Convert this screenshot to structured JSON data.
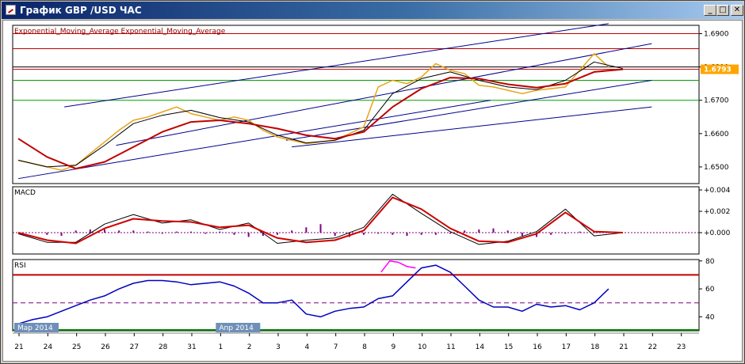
{
  "window": {
    "title": "График GBP /USD  ЧАС",
    "buttons": {
      "minimize": "_",
      "maximize": "□",
      "close": "✕"
    }
  },
  "colors": {
    "price": "#e8a317",
    "ema_fast": "#000000",
    "ema_slow": "#c00000",
    "channel": "#00008b",
    "level_red": "#c00000",
    "level_green": "#00a000",
    "level_dark": "#000000",
    "macd_line": "#000000",
    "macd_signal": "#d00000",
    "macd_hist": "#800080",
    "rsi_line": "#0000c0",
    "rsi_overbought": "#ff00ff",
    "rsi_upper": "#c00000",
    "rsi_lower": "#008000",
    "rsi_mid": "#800080",
    "current_price_label": "#ffa500"
  },
  "chart_data": [
    {
      "type": "line",
      "panel": "price",
      "indicator_legend": "Exponential_Moving_Average Exponential_Moving_Average",
      "y_ticks": [
        "1.6900",
        "1.6800",
        "1.6700",
        "1.6600",
        "1.6500"
      ],
      "ylim": [
        1.645,
        1.6925
      ],
      "current_price": "1.6793",
      "horizontal_levels": [
        {
          "value": 1.69,
          "color": "level_red"
        },
        {
          "value": 1.6855,
          "color": "level_red"
        },
        {
          "value": 1.68,
          "color": "level_dark"
        },
        {
          "value": 1.6793,
          "color": "level_red"
        },
        {
          "value": 1.676,
          "color": "level_green"
        },
        {
          "value": 1.67,
          "color": "level_green"
        }
      ],
      "trend_lines": [
        {
          "from": [
            0.0,
            1.6465
          ],
          "to": [
            16.4,
            1.67
          ]
        },
        {
          "from": [
            1.6,
            1.668
          ],
          "to": [
            20.5,
            1.693
          ]
        },
        {
          "from": [
            3.4,
            1.6565
          ],
          "to": [
            22.0,
            1.687
          ]
        },
        {
          "from": [
            9.3,
            1.658
          ],
          "to": [
            22.0,
            1.676
          ]
        },
        {
          "from": [
            9.5,
            1.656
          ],
          "to": [
            22.0,
            1.668
          ]
        }
      ],
      "series": [
        {
          "key": "price",
          "x": [
            0,
            0.5,
            1,
            1.5,
            2,
            2.5,
            3,
            3.5,
            4,
            4.5,
            5,
            5.5,
            6,
            6.5,
            7,
            7.5,
            8,
            8.5,
            9,
            9.5,
            10,
            10.5,
            11,
            11.5,
            12,
            12.5,
            13,
            13.5,
            14,
            14.5,
            15,
            15.5,
            16,
            16.5,
            17,
            17.5,
            18,
            18.5,
            19,
            19.5,
            20,
            20.5
          ],
          "values": [
            1.652,
            1.651,
            1.65,
            1.649,
            1.6505,
            1.654,
            1.6575,
            1.661,
            1.664,
            1.665,
            1.6665,
            1.668,
            1.666,
            1.665,
            1.664,
            1.665,
            1.664,
            1.661,
            1.659,
            1.658,
            1.657,
            1.6575,
            1.658,
            1.66,
            1.662,
            1.674,
            1.676,
            1.675,
            1.677,
            1.681,
            1.679,
            1.678,
            1.6745,
            1.674,
            1.673,
            1.672,
            1.673,
            1.6735,
            1.674,
            1.679,
            1.684,
            1.68
          ]
        },
        {
          "key": "ema_fast",
          "x": [
            0,
            1,
            2,
            3,
            4,
            5,
            6,
            7,
            8,
            9,
            10,
            11,
            12,
            13,
            14,
            15,
            16,
            17,
            18,
            19,
            20,
            21
          ],
          "values": [
            1.652,
            1.65,
            1.6505,
            1.6565,
            1.663,
            1.6655,
            1.667,
            1.6648,
            1.6635,
            1.6595,
            1.6572,
            1.658,
            1.661,
            1.672,
            1.6765,
            1.6785,
            1.676,
            1.674,
            1.6732,
            1.676,
            1.6815,
            1.6795
          ]
        },
        {
          "key": "ema_slow",
          "x": [
            0,
            1,
            2,
            3,
            4,
            5,
            6,
            7,
            8,
            9,
            10,
            11,
            12,
            13,
            14,
            15,
            16,
            17,
            18,
            19,
            20,
            21
          ],
          "values": [
            1.6585,
            1.653,
            1.6495,
            1.6515,
            1.656,
            1.6605,
            1.6635,
            1.664,
            1.663,
            1.6615,
            1.6595,
            1.6585,
            1.6605,
            1.668,
            1.6735,
            1.6768,
            1.6765,
            1.6748,
            1.6738,
            1.675,
            1.6785,
            1.6793
          ]
        }
      ]
    },
    {
      "type": "line",
      "panel": "macd",
      "title": "MACD",
      "y_ticks": [
        "+0.004",
        "+0.002",
        "+0.000"
      ],
      "ylim": [
        -0.002,
        0.0043
      ],
      "series": [
        {
          "key": "macd_line",
          "x": [
            0,
            1,
            2,
            3,
            4,
            5,
            6,
            7,
            8,
            9,
            10,
            11,
            12,
            13,
            14,
            15,
            16,
            17,
            18,
            19,
            20,
            21
          ],
          "values": [
            -0.0001,
            -0.0009,
            -0.0009,
            0.0008,
            0.0017,
            0.0009,
            0.0012,
            0.0003,
            0.0009,
            -0.001,
            -0.0007,
            -0.0005,
            0.0005,
            0.0036,
            0.0018,
            0.0001,
            -0.0011,
            -0.0008,
            0.0001,
            0.0022,
            -0.0003,
            0.0
          ]
        },
        {
          "key": "macd_signal",
          "x": [
            0,
            1,
            2,
            3,
            4,
            5,
            6,
            7,
            8,
            9,
            10,
            11,
            12,
            13,
            14,
            15,
            16,
            17,
            18,
            19,
            20,
            21
          ],
          "values": [
            0.0,
            -0.0007,
            -0.001,
            0.0004,
            0.0013,
            0.0011,
            0.001,
            0.0005,
            0.0007,
            -0.0005,
            -0.0009,
            -0.0007,
            0.0002,
            0.0033,
            0.0022,
            0.0004,
            -0.0008,
            -0.0009,
            -0.0001,
            0.0019,
            0.0001,
            0.0
          ]
        },
        {
          "key": "macd_hist",
          "x": [
            1,
            1.5,
            2,
            2.5,
            3,
            3.5,
            4,
            4.5,
            5,
            5.5,
            6,
            6.5,
            7,
            7.5,
            8,
            8.5,
            9,
            9.5,
            10,
            10.5,
            11,
            11.5,
            12,
            12.5,
            13,
            13.5,
            14,
            14.5,
            15,
            15.5,
            16,
            16.5,
            17,
            17.5,
            18,
            18.5,
            19,
            19.5,
            20,
            20.5
          ],
          "values": [
            -0.0002,
            -0.0003,
            0.0002,
            0.0003,
            0.0003,
            0.0002,
            0.0002,
            0.0001,
            -0.0001,
            0.0001,
            0.0001,
            -0.0001,
            0.0001,
            -0.0002,
            -0.0004,
            -0.0003,
            -0.0002,
            0.0002,
            0.0005,
            0.0008,
            -0.0003,
            -0.0004,
            -0.0002,
            -0.0001,
            -0.0002,
            -0.0003,
            -0.0002,
            -0.0002,
            -0.0001,
            0.0002,
            0.0003,
            0.0004,
            0.0002,
            -0.0003,
            -0.0004,
            -0.0002,
            -0.0001,
            0.0001,
            0.0,
            0.0
          ]
        }
      ]
    },
    {
      "type": "line",
      "panel": "rsi",
      "title": "RSI",
      "y_ticks": [
        "80",
        "60",
        "40"
      ],
      "ylim": [
        30,
        81
      ],
      "levels": {
        "upper": 70,
        "mid": 50,
        "lower": 30
      },
      "series": [
        {
          "key": "rsi_line",
          "x": [
            0,
            0.5,
            1,
            1.5,
            2,
            2.5,
            3,
            3.5,
            4,
            4.5,
            5,
            5.5,
            6,
            6.5,
            7,
            7.5,
            8,
            8.5,
            9,
            9.5,
            10,
            10.5,
            11,
            11.5,
            12,
            12.5,
            13,
            13.5,
            14,
            14.5,
            15,
            15.5,
            16,
            16.5,
            17,
            17.5,
            18,
            18.5,
            19,
            19.5,
            20,
            20.5
          ],
          "values": [
            35,
            38,
            40,
            44,
            48,
            52,
            55,
            60,
            64,
            66,
            66,
            65,
            63,
            64,
            65,
            62,
            57,
            50,
            50,
            52,
            42,
            40,
            44,
            46,
            47,
            53,
            55,
            65,
            75,
            77,
            72,
            62,
            52,
            47,
            47,
            44,
            49,
            47,
            48,
            45,
            50,
            60
          ]
        },
        {
          "key": "rsi_overbought",
          "x": [
            12.6,
            12.9,
            13.2,
            13.5,
            13.8
          ],
          "values": [
            72,
            80,
            79,
            76,
            75
          ]
        }
      ]
    }
  ],
  "x_axis": {
    "labels": [
      "21",
      "24",
      "25",
      "26",
      "27",
      "28",
      "31",
      "1",
      "2",
      "3",
      "4",
      "7",
      "8",
      "9",
      "10",
      "11",
      "14",
      "15",
      "16",
      "17",
      "18",
      "21",
      "22",
      "23"
    ],
    "month_markers": [
      {
        "label": "Мар 2014",
        "index": 0
      },
      {
        "label": "Апр 2014",
        "index": 7
      }
    ]
  }
}
